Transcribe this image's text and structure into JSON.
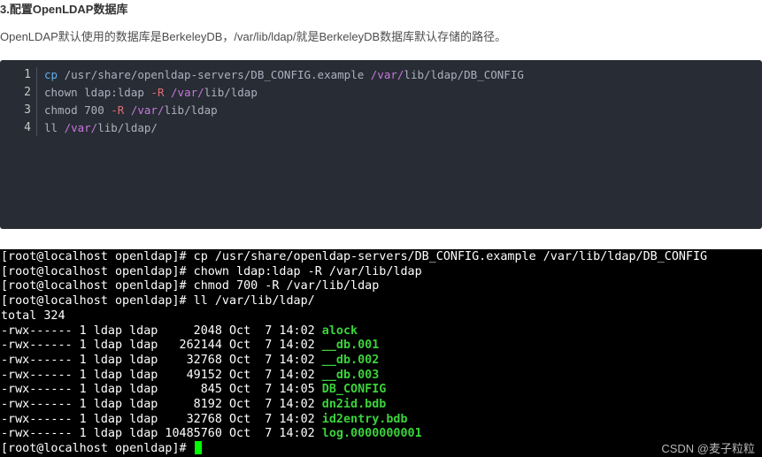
{
  "heading": "3.配置OpenLDAP数据库",
  "paragraph": "OpenLDAP默认使用的数据库是BerkeleyDB，/var/lib/ldap/就是BerkeleyDB数据库默认存储的路径。",
  "code_block": {
    "lines": [
      {
        "number": "1",
        "parts": [
          [
            "kw",
            "cp"
          ],
          [
            "dflt",
            " /usr/share/openldap-servers/DB_CONFIG.example "
          ],
          [
            "var",
            "/var/"
          ],
          [
            "dflt",
            "lib/ldap/DB_CONFIG"
          ]
        ]
      },
      {
        "number": "2",
        "parts": [
          [
            "dflt",
            "chown ldap:ldap "
          ],
          [
            "dash",
            "-R"
          ],
          [
            "dflt",
            " "
          ],
          [
            "var",
            "/var/"
          ],
          [
            "dflt",
            "lib/ldap"
          ]
        ]
      },
      {
        "number": "3",
        "parts": [
          [
            "dflt",
            "chmod 700 "
          ],
          [
            "dash",
            "-R"
          ],
          [
            "dflt",
            " "
          ],
          [
            "var",
            "/var/"
          ],
          [
            "dflt",
            "lib/ldap"
          ]
        ]
      },
      {
        "number": "4",
        "parts": [
          [
            "dflt",
            "ll "
          ],
          [
            "var",
            "/var/"
          ],
          [
            "dflt",
            "lib/ldap/"
          ]
        ]
      }
    ]
  },
  "terminal": {
    "lines": [
      {
        "text": "[root@localhost openldap]# cp /usr/share/openldap-servers/DB_CONFIG.example /var/lib/ldap/DB_CONFIG",
        "file": ""
      },
      {
        "text": "[root@localhost openldap]# chown ldap:ldap -R /var/lib/ldap",
        "file": ""
      },
      {
        "text": "[root@localhost openldap]# chmod 700 -R /var/lib/ldap",
        "file": ""
      },
      {
        "text": "[root@localhost openldap]# ll /var/lib/ldap/",
        "file": ""
      },
      {
        "text": "total 324",
        "file": ""
      },
      {
        "text": "-rwx------ 1 ldap ldap     2048 Oct  7 14:02 ",
        "file": "alock"
      },
      {
        "text": "-rwx------ 1 ldap ldap   262144 Oct  7 14:02 ",
        "file": "__db.001"
      },
      {
        "text": "-rwx------ 1 ldap ldap    32768 Oct  7 14:02 ",
        "file": "__db.002"
      },
      {
        "text": "-rwx------ 1 ldap ldap    49152 Oct  7 14:02 ",
        "file": "__db.003"
      },
      {
        "text": "-rwx------ 1 ldap ldap      845 Oct  7 14:05 ",
        "file": "DB_CONFIG"
      },
      {
        "text": "-rwx------ 1 ldap ldap     8192 Oct  7 14:02 ",
        "file": "dn2id.bdb"
      },
      {
        "text": "-rwx------ 1 ldap ldap    32768 Oct  7 14:02 ",
        "file": "id2entry.bdb"
      },
      {
        "text": "-rwx------ 1 ldap ldap 10485760 Oct  7 14:02 ",
        "file": "log.0000000001"
      },
      {
        "text": "[root@localhost openldap]# ",
        "file": "",
        "cursor": true
      }
    ]
  },
  "watermark": "CSDN @麦子粒粒",
  "colors": {
    "code_bg": "#282c34",
    "terminal_bg": "#000000",
    "file_green": "#3bd23b",
    "cursor": "#00ff00"
  }
}
